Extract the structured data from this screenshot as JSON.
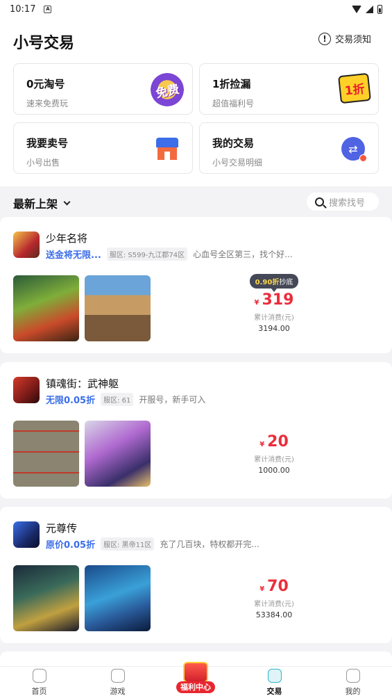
{
  "status_bar": {
    "time": "10:17",
    "notification_icon": "A"
  },
  "header": {
    "title": "小号交易",
    "notice_label": "交易须知",
    "cards": [
      {
        "title": "0元淘号",
        "subtitle": "速来免费玩",
        "art_text": "免费",
        "icon": "free-icon"
      },
      {
        "title": "1折捡漏",
        "subtitle": "超值福利号",
        "art_text": "1折",
        "icon": "discount-icon"
      },
      {
        "title": "我要卖号",
        "subtitle": "小号出售",
        "icon": "shop-icon"
      },
      {
        "title": "我的交易",
        "subtitle": "小号交易明细",
        "icon": "swap-icon"
      }
    ]
  },
  "section": {
    "title": "最新上架",
    "search_placeholder": "搜索找号"
  },
  "listings": [
    {
      "name": "少年名将",
      "promo": "送金将无限...",
      "server": "服区: S599-九江郡74区",
      "desc": "心血号全区第三，找个好...",
      "badge_prefix": "0.90折",
      "badge_suffix": "抄底",
      "currency": "¥",
      "price": "319",
      "acc_label": "累计消费(元)",
      "acc_value": "3194.00"
    },
    {
      "name": "镇魂街：武神躯",
      "promo": "无限0.05折",
      "server": "服区: 61",
      "desc": "开服号，新手可入",
      "currency": "¥",
      "price": "20",
      "acc_label": "累计消费(元)",
      "acc_value": "1000.00"
    },
    {
      "name": "元尊传",
      "promo": "原价0.05折",
      "server": "服区: 黑帝11区",
      "desc": "充了几百块，特权都开完...",
      "currency": "¥",
      "price": "70",
      "acc_label": "累计消费(元)",
      "acc_value": "53384.00"
    }
  ],
  "tabbar": {
    "tabs": [
      {
        "label": "首页",
        "icon": "home-icon"
      },
      {
        "label": "游戏",
        "icon": "gamepad-icon"
      },
      {
        "label": "福利中心",
        "icon": "gift-icon"
      },
      {
        "label": "交易",
        "icon": "trade-icon",
        "active": true
      },
      {
        "label": "我的",
        "icon": "profile-icon"
      }
    ]
  },
  "colors": {
    "accent_red": "#ea2e3c",
    "promo_blue": "#3b6ee8",
    "tab_active": "#2fb8c8"
  }
}
